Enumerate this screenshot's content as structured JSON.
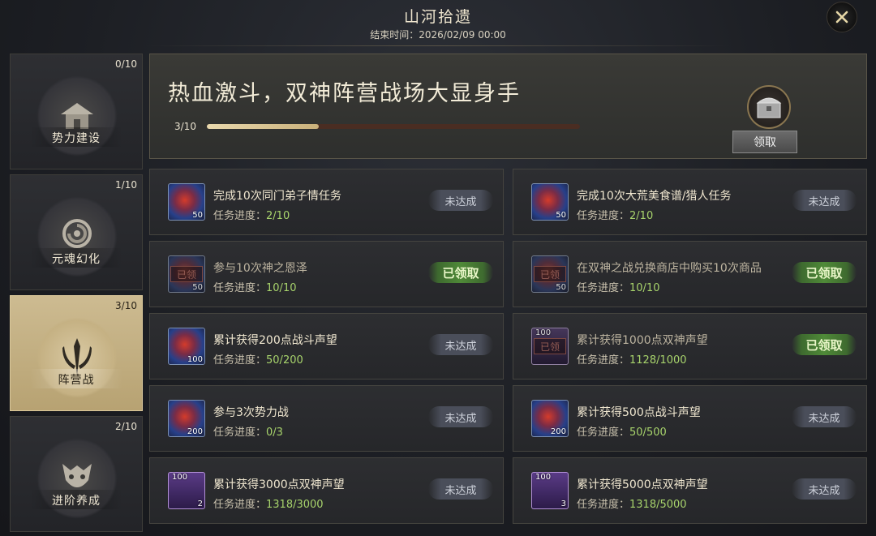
{
  "header": {
    "title": "山河拾遗",
    "end_time": "结束时间：2026/02/09 00:00"
  },
  "sidebar": [
    {
      "count": "0/10",
      "label": "势力建设",
      "icon": "pavilion-icon"
    },
    {
      "count": "1/10",
      "label": "元魂幻化",
      "icon": "swirl-icon"
    },
    {
      "count": "3/10",
      "label": "阵营战",
      "icon": "trident-icon",
      "active": true
    },
    {
      "count": "2/10",
      "label": "进阶养成",
      "icon": "beast-mask-icon"
    }
  ],
  "banner": {
    "title": "热血激斗，双神阵营战场大显身手",
    "progress_text": "3/10",
    "progress": 0.3,
    "claim_label": "领取",
    "reward_icon": "chest-icon"
  },
  "progress_label": "任务进度：",
  "tasks": [
    {
      "name": "完成10次同门弟子情任务",
      "progress": "2/10",
      "status": "未达成",
      "qty": "50",
      "icon": "fire-ice-orb-icon"
    },
    {
      "name": "完成10次大荒美食谱/猎人任务",
      "progress": "2/10",
      "status": "未达成",
      "qty": "50",
      "icon": "fire-ice-orb-icon"
    },
    {
      "name": "参与10次神之恩泽",
      "progress": "10/10",
      "status": "已领取",
      "qty": "50",
      "stamp": "已领",
      "icon": "fire-ice-orb-icon"
    },
    {
      "name": "在双神之战兑换商店中购买10次商品",
      "progress": "10/10",
      "status": "已领取",
      "qty": "50",
      "stamp": "已领",
      "icon": "fire-ice-orb-icon"
    },
    {
      "name": "累计获得200点战斗声望",
      "progress": "50/200",
      "status": "未达成",
      "qty": "100",
      "icon": "fire-ice-orb-icon"
    },
    {
      "name": "累计获得1000点双神声望",
      "progress": "1128/1000",
      "status": "已领取",
      "qty": "100",
      "stamp": "已领",
      "icon": "purple-token-icon"
    },
    {
      "name": "参与3次势力战",
      "progress": "0/3",
      "status": "未达成",
      "qty": "200",
      "icon": "fire-ice-orb-icon"
    },
    {
      "name": "累计获得500点战斗声望",
      "progress": "50/500",
      "status": "未达成",
      "qty": "200",
      "icon": "fire-ice-orb-icon"
    },
    {
      "name": "累计获得3000点双神声望",
      "progress": "1318/3000",
      "status": "未达成",
      "qty": "100",
      "sub": "2",
      "icon": "purple-token-icon"
    },
    {
      "name": "累计获得5000点双神声望",
      "progress": "1318/5000",
      "status": "未达成",
      "qty": "100",
      "sub": "3",
      "icon": "purple-token-icon"
    }
  ],
  "colors": {
    "accent_gold": "#cdbb91",
    "progress_green": "#a8d46c",
    "claimed_green": "#4f8a38"
  }
}
